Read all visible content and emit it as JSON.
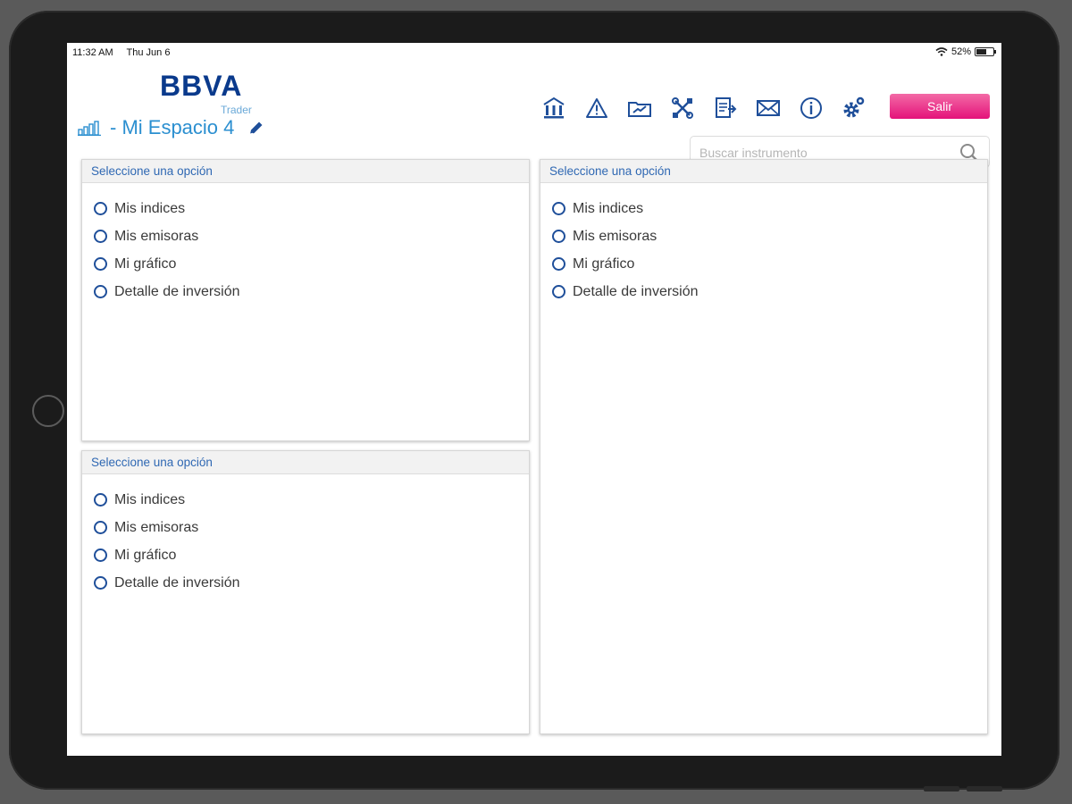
{
  "status_bar": {
    "time": "11:32 AM",
    "date": "Thu Jun 6",
    "battery": "52%"
  },
  "header": {
    "logo": "BBVA",
    "logo_sub": "Trader",
    "workspace_title": "- Mi Espacio 4",
    "logout_label": "Salir",
    "toolbar_icons": [
      "bank-icon",
      "alert-icon",
      "folder-chart-icon",
      "tools-icon",
      "report-icon",
      "mail-icon",
      "info-icon",
      "settings-icon"
    ]
  },
  "search": {
    "placeholder": "Buscar instrumento",
    "value": ""
  },
  "panels": [
    {
      "header": "Seleccione una opción",
      "options": [
        "Mis indices",
        "Mis emisoras",
        "Mi gráfico",
        "Detalle de inversión"
      ]
    },
    {
      "header": "Seleccione una opción",
      "options": [
        "Mis indices",
        "Mis emisoras",
        "Mi gráfico",
        "Detalle de inversión"
      ]
    },
    {
      "header": "Seleccione una opción",
      "options": [
        "Mis indices",
        "Mis emisoras",
        "Mi gráfico",
        "Detalle de inversión"
      ]
    }
  ],
  "colors": {
    "brand": "#0a3a8c",
    "accent": "#2b8fd0",
    "logout": "#e4127a",
    "panel_header_text": "#2f68b3"
  }
}
